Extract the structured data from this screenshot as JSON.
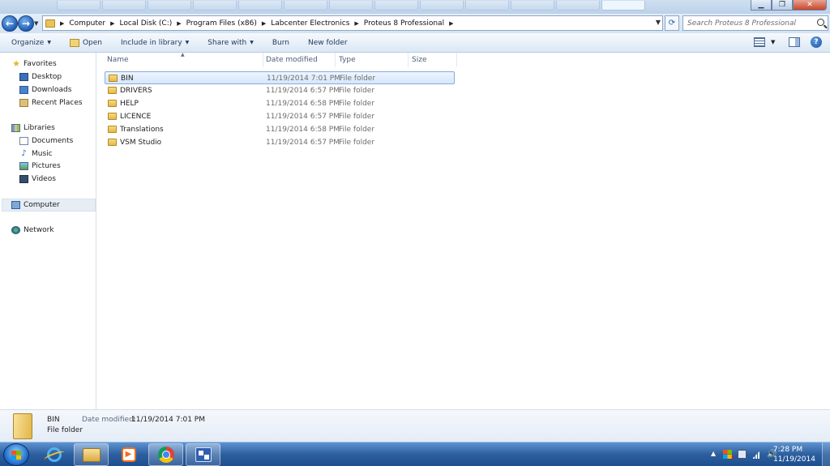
{
  "titlebar": {
    "minimize_icon": "minimize-icon",
    "maximize_icon": "restore-icon",
    "close_icon": "close-icon"
  },
  "address": {
    "crumbs": [
      "Computer",
      "Local Disk (C:)",
      "Program Files (x86)",
      "Labcenter Electronics",
      "Proteus 8 Professional"
    ],
    "search_placeholder": "Search Proteus 8 Professional"
  },
  "toolbar": {
    "organize": "Organize",
    "open": "Open",
    "include_in_library": "Include in library",
    "share_with": "Share with",
    "burn": "Burn",
    "new_folder": "New folder"
  },
  "nav": {
    "favorites": "Favorites",
    "desktop": "Desktop",
    "downloads": "Downloads",
    "recent_places": "Recent Places",
    "libraries": "Libraries",
    "documents": "Documents",
    "music": "Music",
    "pictures": "Pictures",
    "videos": "Videos",
    "computer": "Computer",
    "network": "Network"
  },
  "columns": {
    "name": "Name",
    "date_modified": "Date modified",
    "type": "Type",
    "size": "Size"
  },
  "files": [
    {
      "name": "BIN",
      "date": "11/19/2014 7:01 PM",
      "type": "File folder"
    },
    {
      "name": "DRIVERS",
      "date": "11/19/2014 6:57 PM",
      "type": "File folder"
    },
    {
      "name": "HELP",
      "date": "11/19/2014 6:58 PM",
      "type": "File folder"
    },
    {
      "name": "LICENCE",
      "date": "11/19/2014 6:57 PM",
      "type": "File folder"
    },
    {
      "name": "Translations",
      "date": "11/19/2014 6:58 PM",
      "type": "File folder"
    },
    {
      "name": "VSM Studio",
      "date": "11/19/2014 6:57 PM",
      "type": "File folder"
    }
  ],
  "details": {
    "name": "BIN",
    "type": "File folder",
    "date_label": "Date modified:",
    "date_value": "11/19/2014 7:01 PM"
  },
  "taskbar": {
    "time": "7:28 PM",
    "date": "11/19/2014"
  },
  "colors": {
    "selection": "#d6e7fb",
    "selection_border": "#84acdd",
    "taskbar": "#2d5f9f",
    "header_text": "#4c607a"
  }
}
